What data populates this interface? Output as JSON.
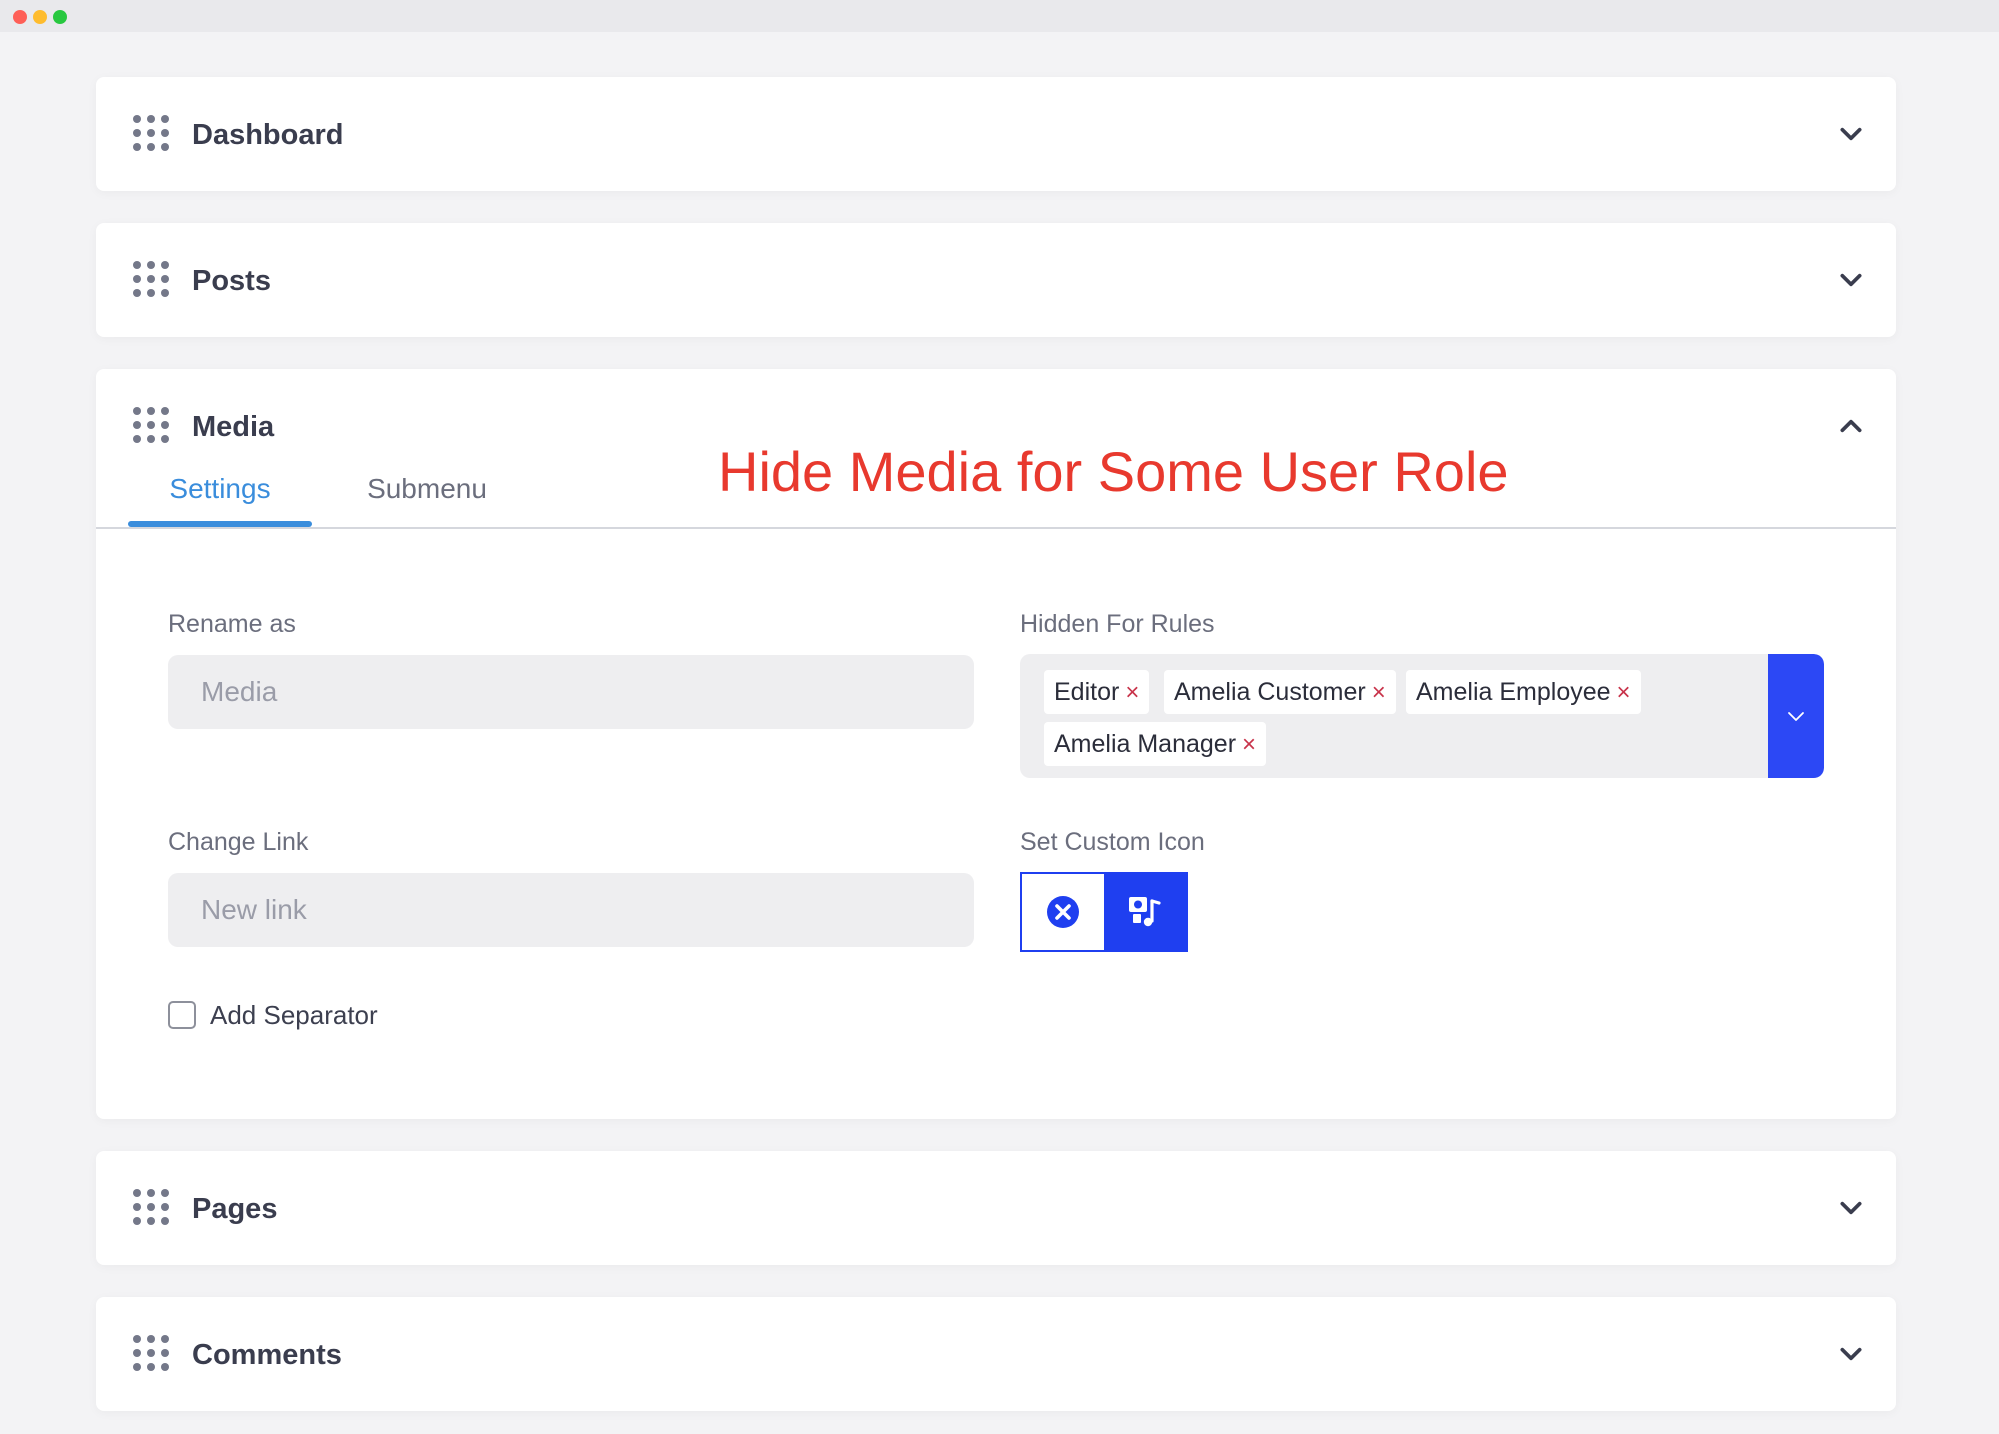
{
  "window": {
    "controls": [
      "close",
      "minimize",
      "maximize"
    ]
  },
  "annotation": "Hide Media for Some User Role",
  "panels": [
    {
      "title": "Dashboard",
      "state": "collapsed",
      "chevron_icon": "chevron-down-icon"
    },
    {
      "title": "Posts",
      "state": "collapsed",
      "chevron_icon": "chevron-down-icon"
    },
    {
      "title": "Media",
      "state": "expanded",
      "chevron_icon": "chevron-up-icon",
      "tabs": [
        {
          "label": "Settings",
          "active": true
        },
        {
          "label": "Submenu",
          "active": false
        }
      ],
      "settings": {
        "rename": {
          "label": "Rename as",
          "placeholder": "Media",
          "value": ""
        },
        "hidden_for": {
          "label": "Hidden For Rules",
          "selected": [
            "Editor",
            "Amelia Customer",
            "Amelia Employee",
            "Amelia Manager"
          ],
          "remove_glyph": "×"
        },
        "change_link": {
          "label": "Change Link",
          "placeholder": "New link",
          "value": ""
        },
        "custom_icon": {
          "label": "Set Custom Icon",
          "clear_icon": "clear-circle-icon",
          "picker_icon": "icon-picker-icon"
        },
        "separator": {
          "label": "Add Separator",
          "checked": false
        }
      }
    },
    {
      "title": "Pages",
      "state": "collapsed",
      "chevron_icon": "chevron-down-icon"
    },
    {
      "title": "Comments",
      "state": "collapsed",
      "chevron_icon": "chevron-down-icon"
    }
  ],
  "colors": {
    "accent_blue": "#3a8ddc",
    "primary_button": "#1f3ff0",
    "annotation_red": "#e8392e",
    "tag_remove": "#c8334a"
  }
}
